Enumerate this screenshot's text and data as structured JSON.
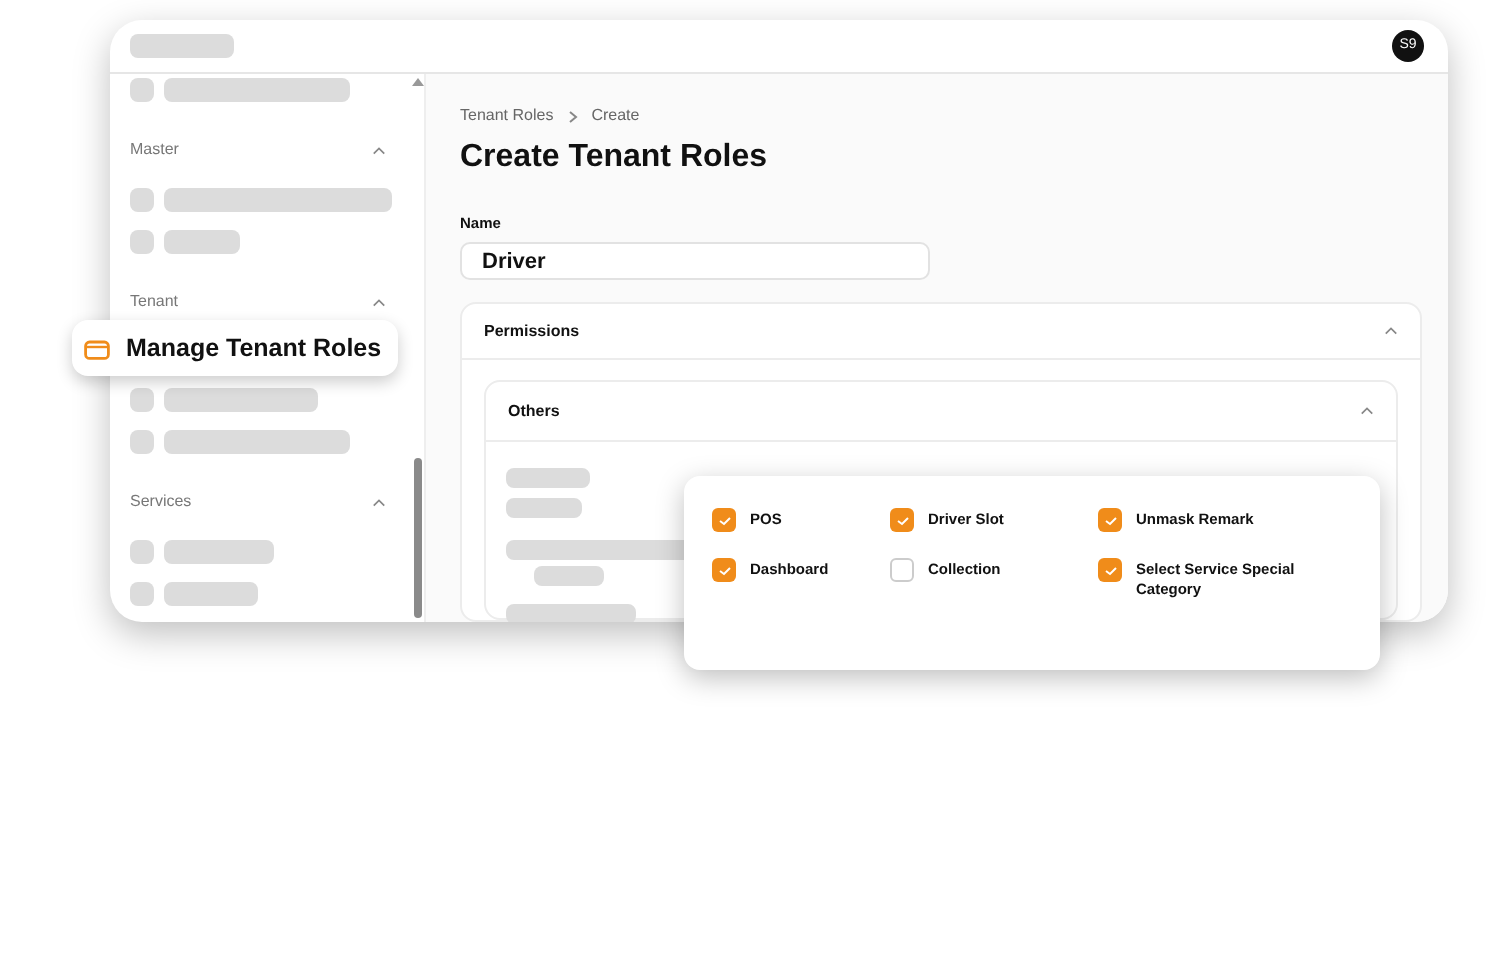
{
  "avatar": {
    "initials": "S9"
  },
  "sidebar": {
    "sections": [
      {
        "title": "Master",
        "expanded": true
      },
      {
        "title": "Tenant",
        "expanded": true
      },
      {
        "title": "Services",
        "expanded": true
      }
    ]
  },
  "callout": {
    "label": "Manage Tenant Roles"
  },
  "breadcrumb": [
    "Tenant Roles",
    "Create"
  ],
  "page_title": "Create Tenant Roles",
  "name_field": {
    "label": "Name",
    "value": "Driver"
  },
  "permissions": {
    "title": "Permissions",
    "expanded": true,
    "groups": [
      {
        "title": "Others",
        "expanded": true
      }
    ]
  },
  "popup": {
    "items": [
      {
        "label": "POS",
        "checked": true
      },
      {
        "label": "Driver Slot",
        "checked": true
      },
      {
        "label": "Unmask Remark",
        "checked": true
      },
      {
        "label": "Dashboard",
        "checked": true
      },
      {
        "label": "Collection",
        "checked": false
      },
      {
        "label": "Select Service Special Category",
        "checked": true
      }
    ]
  }
}
